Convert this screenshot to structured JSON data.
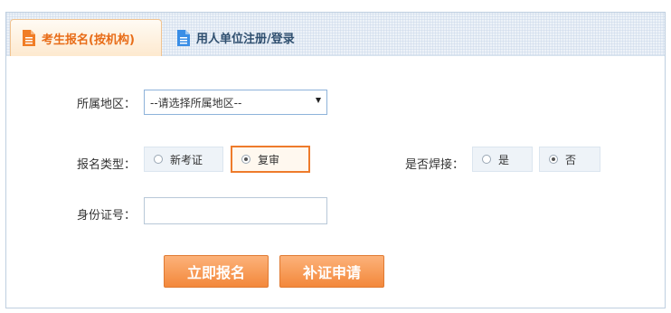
{
  "tabs": {
    "active_label": "考生报名(按机构)",
    "inactive_label": "用人单位注册/登录"
  },
  "form": {
    "region_label": "所属地区：",
    "region_select_value": "--请选择所属地区--",
    "type_label": "报名类型：",
    "type_options": [
      "新考证",
      "复审"
    ],
    "type_selected": "复审",
    "welding_label": "是否焊接：",
    "welding_options": [
      "是",
      "否"
    ],
    "welding_selected": "否",
    "id_label": "身份证号：",
    "id_value": ""
  },
  "buttons": {
    "register": "立即报名",
    "reissue": "补证申请"
  },
  "colors": {
    "accent_orange": "#f3883b",
    "active_tab_text": "#e86c17",
    "inactive_tab_text": "#2f4f6f",
    "select_border": "#8eb3da"
  },
  "icons": {
    "active_tab_icon": "document-icon",
    "inactive_tab_icon": "document-icon",
    "select_icon": "chevron-down-icon"
  }
}
